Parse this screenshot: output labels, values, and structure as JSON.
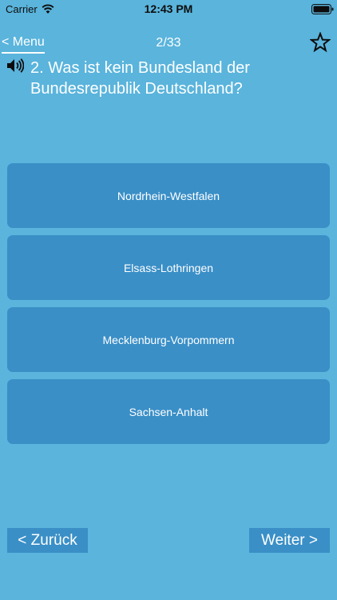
{
  "status_bar": {
    "carrier": "Carrier",
    "time": "12:43 PM"
  },
  "nav": {
    "back_label": "< Menu",
    "counter": "2/33"
  },
  "question": {
    "text": "2. Was ist kein Bundesland der Bundesrepublik Deutschland?"
  },
  "answers": [
    {
      "label": "Nordrhein-Westfalen"
    },
    {
      "label": "Elsass-Lothringen"
    },
    {
      "label": "Mecklenburg-Vorpommern"
    },
    {
      "label": "Sachsen-Anhalt"
    }
  ],
  "footer": {
    "back_label": "< Zurück",
    "next_label": "Weiter >"
  },
  "colors": {
    "background": "#5ab4dc",
    "button": "#3a8fc7",
    "text": "#ffffff"
  },
  "icons": {
    "wifi": "wifi-icon",
    "battery": "battery-icon",
    "favorite": "star-icon",
    "audio": "speaker-icon"
  }
}
